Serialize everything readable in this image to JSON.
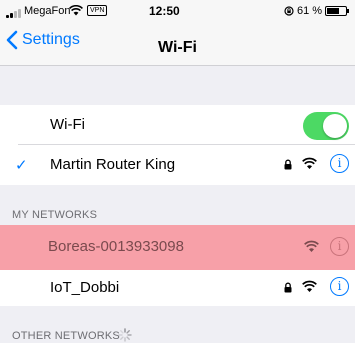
{
  "status": {
    "carrier": "MegaFon",
    "vpn": "VPN",
    "time": "12:50",
    "battery_percent": "61 %",
    "battery_level": 0.61
  },
  "nav": {
    "back_label": "Settings",
    "title": "Wi-Fi"
  },
  "wifi_toggle": {
    "label": "Wi-Fi",
    "on": true
  },
  "connected": {
    "check": "✓",
    "name": "Martin Router King",
    "info": "i"
  },
  "sections": {
    "my_networks": "MY NETWORKS",
    "other_networks": "OTHER NETWORKS"
  },
  "my_networks": [
    {
      "name": "Boreas-0013933098",
      "secured": false,
      "info": "i"
    },
    {
      "name": "IoT_Dobbi",
      "secured": true,
      "info": "i"
    }
  ],
  "colors": {
    "accent": "#007aff",
    "toggle_on": "#4cd964",
    "highlight": "#f7a0a8"
  }
}
